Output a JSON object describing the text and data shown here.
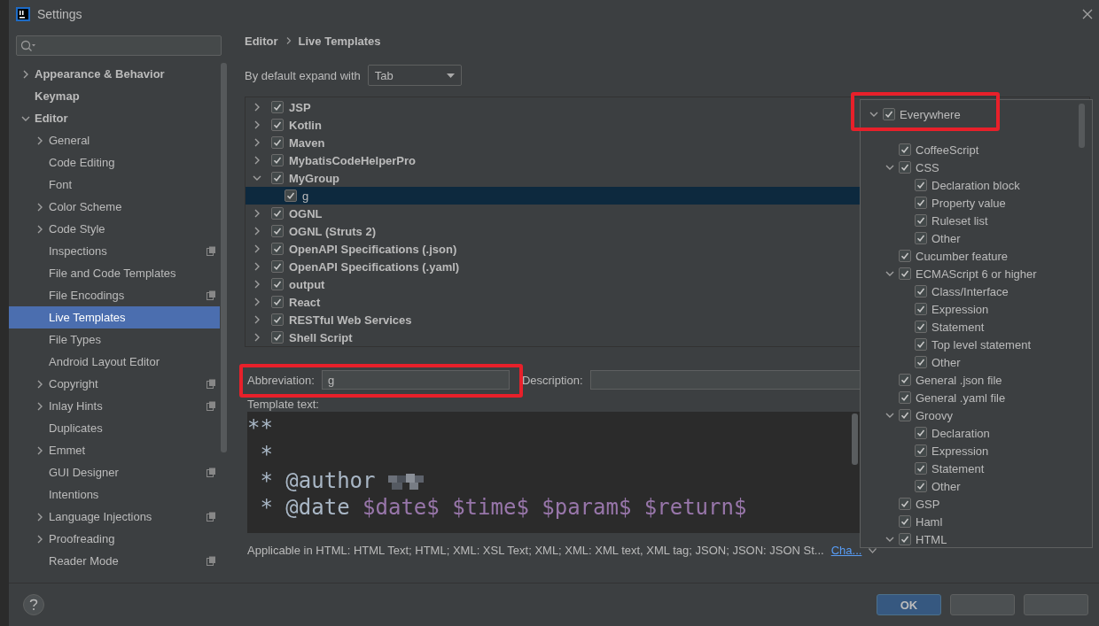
{
  "window": {
    "title": "Settings"
  },
  "sidebar": {
    "items": [
      {
        "label": "Appearance & Behavior",
        "expanded": false
      },
      {
        "label": "Keymap"
      },
      {
        "label": "Editor",
        "expanded": true,
        "children": [
          {
            "label": "General",
            "expanded": false
          },
          {
            "label": "Code Editing"
          },
          {
            "label": "Font"
          },
          {
            "label": "Color Scheme",
            "expanded": false
          },
          {
            "label": "Code Style",
            "expanded": false
          },
          {
            "label": "Inspections",
            "shared": true
          },
          {
            "label": "File and Code Templates"
          },
          {
            "label": "File Encodings",
            "shared": true
          },
          {
            "label": "Live Templates",
            "selected": true
          },
          {
            "label": "File Types"
          },
          {
            "label": "Android Layout Editor"
          },
          {
            "label": "Copyright",
            "expanded": false,
            "shared": true
          },
          {
            "label": "Inlay Hints",
            "expanded": false,
            "shared": true
          },
          {
            "label": "Duplicates"
          },
          {
            "label": "Emmet",
            "expanded": false
          },
          {
            "label": "GUI Designer",
            "shared": true
          },
          {
            "label": "Intentions"
          },
          {
            "label": "Language Injections",
            "expanded": false,
            "shared": true
          },
          {
            "label": "Proofreading",
            "expanded": false
          },
          {
            "label": "Reader Mode",
            "shared": true
          }
        ]
      }
    ]
  },
  "breadcrumb": [
    "Editor",
    "Live Templates"
  ],
  "expand_with": {
    "label": "By default expand with",
    "value": "Tab"
  },
  "templates": [
    {
      "label": "JSP",
      "checked": true,
      "expanded": false
    },
    {
      "label": "Kotlin",
      "checked": true,
      "expanded": false
    },
    {
      "label": "Maven",
      "checked": true,
      "expanded": false
    },
    {
      "label": "MybatisCodeHelperPro",
      "checked": true,
      "expanded": false
    },
    {
      "label": "MyGroup",
      "checked": true,
      "expanded": true,
      "children": [
        {
          "label": "g",
          "checked": true,
          "selected": true
        }
      ]
    },
    {
      "label": "OGNL",
      "checked": true,
      "expanded": false
    },
    {
      "label": "OGNL (Struts 2)",
      "checked": true,
      "expanded": false
    },
    {
      "label": "OpenAPI Specifications (.json)",
      "checked": true,
      "expanded": false
    },
    {
      "label": "OpenAPI Specifications (.yaml)",
      "checked": true,
      "expanded": false
    },
    {
      "label": "output",
      "checked": true,
      "expanded": false
    },
    {
      "label": "React",
      "checked": true,
      "expanded": false
    },
    {
      "label": "RESTful Web Services",
      "checked": true,
      "expanded": false
    },
    {
      "label": "Shell Script",
      "checked": true,
      "expanded": false
    }
  ],
  "abbreviation": {
    "label": "Abbreviation:",
    "value": "g"
  },
  "description": {
    "label": "Description:"
  },
  "template_text": {
    "label": "Template text:",
    "lines": [
      [
        {
          "kind": "plain",
          "text": "**"
        }
      ],
      [
        {
          "kind": "plain",
          "text": " *"
        }
      ],
      [
        {
          "kind": "plain",
          "text": " * @author "
        },
        {
          "kind": "redacted"
        }
      ],
      [
        {
          "kind": "plain",
          "text": " * @date "
        },
        {
          "kind": "variable",
          "text": "$date$"
        },
        {
          "kind": "variable",
          "text": "$time$"
        },
        {
          "kind": "variable",
          "text": "$param$"
        },
        {
          "kind": "variable",
          "text": "$return$"
        }
      ]
    ]
  },
  "applicable": {
    "text": "Applicable in HTML: HTML Text; HTML; XML: XSL Text; XML; XML: XML text, XML tag; JSON; JSON: JSON St...",
    "link": "Cha..."
  },
  "contexts": [
    {
      "label": "Everywhere",
      "checked": true,
      "expanded": true,
      "children": [
        {
          "label": "CoffeeScript",
          "checked": true
        },
        {
          "label": "CSS",
          "checked": true,
          "expanded": true,
          "children": [
            {
              "label": "Declaration block",
              "checked": true
            },
            {
              "label": "Property value",
              "checked": true
            },
            {
              "label": "Ruleset list",
              "checked": true
            },
            {
              "label": "Other",
              "checked": true
            }
          ]
        },
        {
          "label": "Cucumber feature",
          "checked": true
        },
        {
          "label": "ECMAScript 6 or higher",
          "checked": true,
          "expanded": true,
          "children": [
            {
              "label": "Class/Interface",
              "checked": true
            },
            {
              "label": "Expression",
              "checked": true
            },
            {
              "label": "Statement",
              "checked": true
            },
            {
              "label": "Top level statement",
              "checked": true
            },
            {
              "label": "Other",
              "checked": true
            }
          ]
        },
        {
          "label": "General .json file",
          "checked": true
        },
        {
          "label": "General .yaml file",
          "checked": true
        },
        {
          "label": "Groovy",
          "checked": true,
          "expanded": true,
          "children": [
            {
              "label": "Declaration",
              "checked": true
            },
            {
              "label": "Expression",
              "checked": true
            },
            {
              "label": "Statement",
              "checked": true
            },
            {
              "label": "Other",
              "checked": true
            }
          ]
        },
        {
          "label": "GSP",
          "checked": true
        },
        {
          "label": "Haml",
          "checked": true
        },
        {
          "label": "HTML",
          "checked": true,
          "expanded": true
        }
      ]
    }
  ],
  "buttons": [
    {
      "label": "OK",
      "default": true
    },
    {
      "default": false
    },
    {
      "default": false
    }
  ]
}
